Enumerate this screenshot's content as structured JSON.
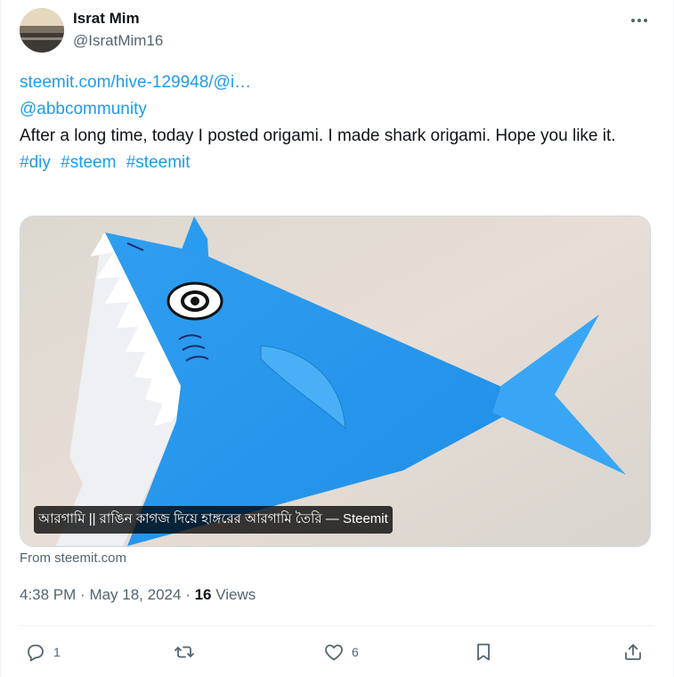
{
  "author": {
    "name": "Israt Mim",
    "handle": "@IsratMim16"
  },
  "post": {
    "link": "steemit.com/hive-129948/@i…",
    "mention": "@abbcommunity",
    "text": "After a long time, today I posted origami. I made shark origami. Hope you like it.",
    "hashtags": [
      "#diy",
      "#steem",
      "#steemit"
    ]
  },
  "media": {
    "caption": "আরগামি || রাঙিন কাগজ দিয়ে হাঙ্গরের আরগামি তৈরি — Steemit",
    "source": "From steemit.com"
  },
  "meta": {
    "time": "4:38 PM",
    "date": "May 18, 2024",
    "views_count": "16",
    "views_label": "Views"
  },
  "actions": {
    "replies": "1",
    "likes": "6"
  },
  "colors": {
    "link": "#1d9bf0",
    "muted": "#536471",
    "shark": "#2196f3"
  },
  "icons": [
    "more-icon",
    "reply-icon",
    "repost-icon",
    "like-icon",
    "bookmark-icon",
    "share-icon"
  ]
}
